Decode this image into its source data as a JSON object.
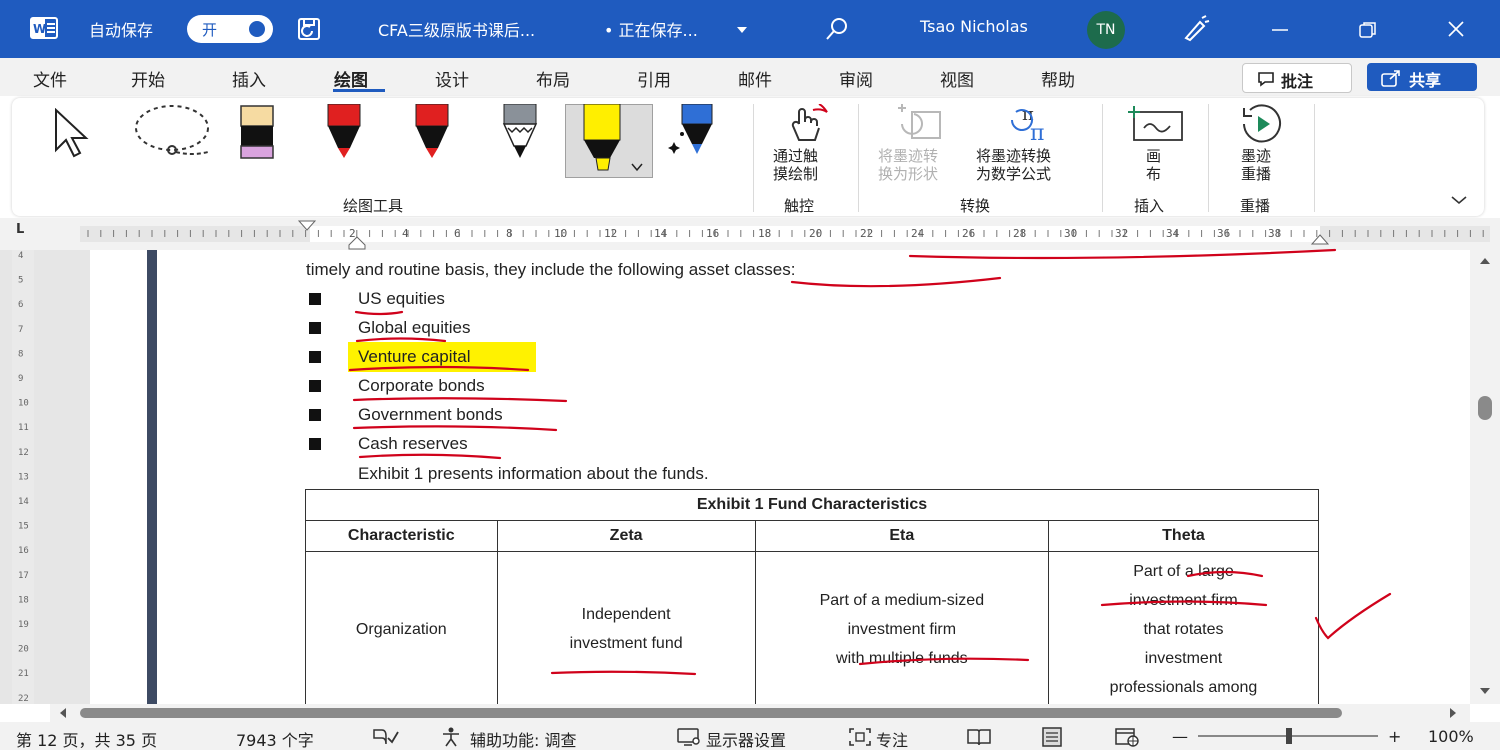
{
  "titlebar": {
    "autosave_label": "自动保存",
    "autosave_state": "开",
    "doc_title": "CFA三级原版书课后...",
    "save_status": "• 正在保存...",
    "user_name": "Tsao Nicholas",
    "user_initials": "TN"
  },
  "ribbon_tabs": [
    "文件",
    "开始",
    "插入",
    "绘图",
    "设计",
    "布局",
    "引用",
    "邮件",
    "审阅",
    "视图",
    "帮助"
  ],
  "active_tab": "绘图",
  "actions": {
    "comment": "批注",
    "share": "共享"
  },
  "ribbon": {
    "touch_draw": [
      "通过触",
      "摸绘制"
    ],
    "ink_to_shape": [
      "将墨迹转",
      "换为形状"
    ],
    "ink_to_math": [
      "将墨迹转换",
      "为数学公式"
    ],
    "canvas": [
      "画",
      "布"
    ],
    "ink_replay": [
      "墨迹",
      "重播"
    ],
    "groups": {
      "drawing_tools": "绘图工具",
      "touch": "触控",
      "convert": "转换",
      "insert": "插入",
      "replay": "重播"
    }
  },
  "ruler": {
    "h_numbers": [
      "2",
      "4",
      "6",
      "8",
      "10",
      "12",
      "14",
      "16",
      "18",
      "20",
      "22",
      "24",
      "26",
      "28",
      "30",
      "32",
      "34",
      "36",
      "38"
    ],
    "v_numbers": [
      "4",
      "5",
      "6",
      "7",
      "8",
      "9",
      "10",
      "11",
      "12",
      "13",
      "14",
      "15",
      "16",
      "17",
      "18",
      "19",
      "20",
      "21",
      "22"
    ]
  },
  "document": {
    "intro_line": "timely and routine basis, they include the following asset classes:",
    "bullets": [
      "US equities",
      "Global equities",
      "Venture capital",
      "Corporate bonds",
      "Government bonds",
      "Cash reserves"
    ],
    "exhibit_intro": "Exhibit 1 presents information about the funds.",
    "table": {
      "caption": "Exhibit 1 Fund Characteristics",
      "headers": [
        "Characteristic",
        "Zeta",
        "Eta",
        "Theta"
      ],
      "row": {
        "label": "Organization",
        "zeta": [
          "Independent",
          "investment fund"
        ],
        "eta": [
          "Part of a medium-sized",
          "investment firm",
          "with multiple funds"
        ],
        "theta": [
          "Part of a large",
          "investment firm",
          "that rotates",
          "investment",
          "professionals among"
        ]
      }
    }
  },
  "statusbar": {
    "page_info": "第 12 页，共 35 页",
    "word_count": "7943 个字",
    "accessibility": "辅助功能: 调查",
    "display_settings": "显示器设置",
    "focus": "专注",
    "zoom_minus": "—",
    "zoom_plus": "+",
    "zoom": "100%"
  },
  "colors": {
    "brand_blue": "#1f5bbf",
    "highlight": "#fff200",
    "ink_red": "#d0021b"
  }
}
